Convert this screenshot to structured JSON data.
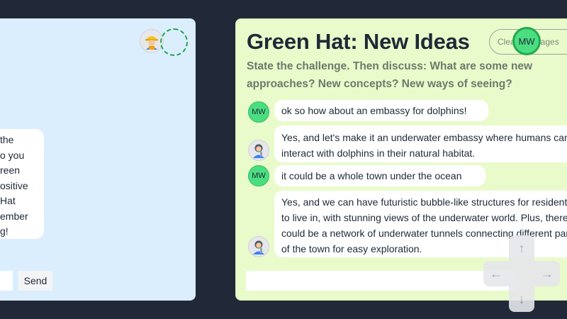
{
  "left_panel": {
    "bubble_lines": [
      "the",
      "o you",
      "reen",
      "ositive",
      "Hat",
      "ember",
      "g!"
    ],
    "send_label": "Send"
  },
  "right_panel": {
    "title": "Green Hat: New Ideas",
    "clear_label": "Clear Messages",
    "user_initials": "MW",
    "prompt": "State the challenge. Then discuss: What are some new approaches? New concepts? New ways of seeing?",
    "messages": [
      {
        "role": "user",
        "avatar": "MW",
        "text": "ok so how about an embassy for dolphins!"
      },
      {
        "role": "bot",
        "text": "Yes, and let's make it an underwater embassy where humans can\ninteract with dolphins in their natural habitat."
      },
      {
        "role": "user",
        "avatar": "MW",
        "text": "it could be a whole town under the ocean"
      },
      {
        "role": "bot",
        "text": "Yes, and we can have futuristic bubble-like structures for residents\nto live in, with stunning views of the underwater world. Plus, there\ncould be a network of underwater tunnels connecting different parts\nof the town for easy exploration."
      }
    ]
  },
  "arrow_pad": {
    "up": "↑",
    "left": "←",
    "right": "→",
    "down": "↓"
  }
}
